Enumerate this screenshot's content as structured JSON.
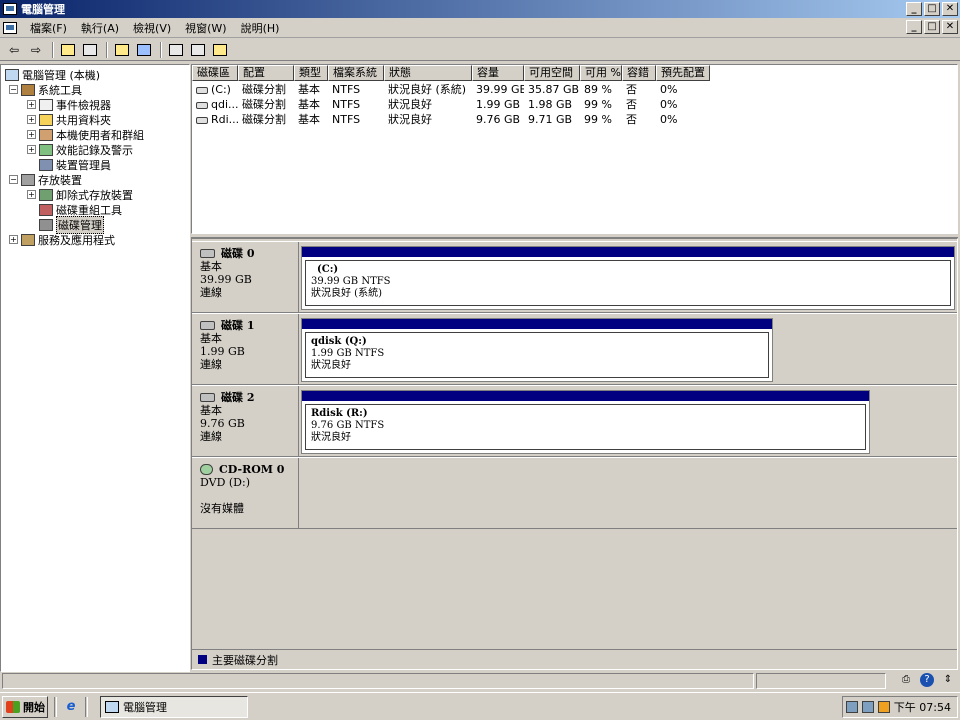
{
  "window": {
    "title": "電腦管理",
    "controls": {
      "minimize": "_",
      "maximize": "□",
      "close": "✕"
    }
  },
  "menu": {
    "items": [
      "檔案(F)",
      "執行(A)",
      "檢視(V)",
      "視窗(W)",
      "說明(H)"
    ]
  },
  "toolbar": {
    "back_icon": "arrow-left-icon",
    "forward_icon": "arrow-right-icon"
  },
  "tree": {
    "root": "電腦管理 (本機)",
    "system_tools": "系統工具",
    "event_viewer": "事件檢視器",
    "shared_folders": "共用資料夾",
    "local_users": "本機使用者和群組",
    "performance": "效能記錄及警示",
    "device_manager": "裝置管理員",
    "storage": "存放裝置",
    "removable_storage": "卸除式存放裝置",
    "defrag": "磁碟重組工具",
    "disk_management": "磁碟管理",
    "services": "服務及應用程式"
  },
  "volume_list": {
    "headers": [
      "磁碟區",
      "配置",
      "類型",
      "檔案系統",
      "狀態",
      "容量",
      "可用空間",
      "可用 %",
      "容錯",
      "預先配置"
    ],
    "rows": [
      [
        "(C:)",
        "磁碟分割",
        "基本",
        "NTFS",
        "狀況良好 (系統)",
        "39.99 GB",
        "35.87 GB",
        "89 %",
        "否",
        "0%"
      ],
      [
        "qdi...",
        "磁碟分割",
        "基本",
        "NTFS",
        "狀況良好",
        "1.99 GB",
        "1.98 GB",
        "99 %",
        "否",
        "0%"
      ],
      [
        "Rdi...",
        "磁碟分割",
        "基本",
        "NTFS",
        "狀況良好",
        "9.76 GB",
        "9.71 GB",
        "99 %",
        "否",
        "0%"
      ]
    ]
  },
  "disks": [
    {
      "name": "磁碟 0",
      "type": "基本",
      "size": "39.99 GB",
      "status": "連線",
      "partition": {
        "name": "(C:)",
        "info": "39.99 GB NTFS",
        "state": "狀況良好 (系統)"
      }
    },
    {
      "name": "磁碟 1",
      "type": "基本",
      "size": "1.99 GB",
      "status": "連線",
      "partition": {
        "name": "qdisk  (Q:)",
        "info": "1.99 GB NTFS",
        "state": "狀況良好"
      }
    },
    {
      "name": "磁碟 2",
      "type": "基本",
      "size": "9.76 GB",
      "status": "連線",
      "partition": {
        "name": "Rdisk  (R:)",
        "info": "9.76 GB NTFS",
        "state": "狀況良好"
      }
    }
  ],
  "cdrom": {
    "name": "CD-ROM 0",
    "drive": "DVD (D:)",
    "media": "沒有媒體"
  },
  "legend": {
    "primary": "主要磁碟分割",
    "color": "#000080"
  },
  "taskbar": {
    "start": "開始",
    "task": "電腦管理",
    "clock": "下午 07:54"
  }
}
